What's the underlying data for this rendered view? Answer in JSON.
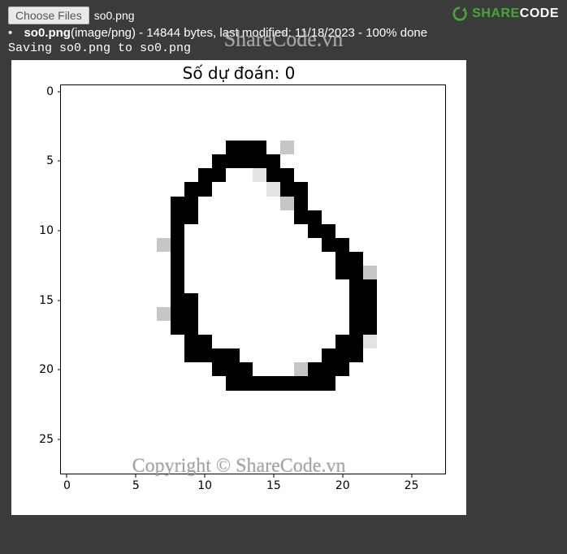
{
  "logo": {
    "share": "SHARE",
    "code": "CODE"
  },
  "watermarks": {
    "center": "ShareCode.vn",
    "bottom": "Copyright © ShareCode.vn"
  },
  "upload": {
    "button_label": "Choose Files",
    "file_label": "so0.png",
    "bullet": "•",
    "fname": "so0.png",
    "info": "(image/png) - 14844 bytes, last modified: 11/18/2023 - 100% done",
    "save_line": "Saving so0.png to so0.png"
  },
  "chart_data": {
    "type": "heatmap",
    "title": "Số dự đoán: 0",
    "xticks": [
      0,
      5,
      10,
      15,
      20,
      25
    ],
    "yticks": [
      0,
      5,
      10,
      15,
      20,
      25
    ],
    "xlim": [
      -0.5,
      27.5
    ],
    "ylim": [
      -0.5,
      27.5
    ],
    "grid_size": [
      28,
      28
    ],
    "cmap": "gray_inverted",
    "pixels": [
      "0000000000000000000000000000",
      "0000000000000000000000000000",
      "0000000000000000000000000000",
      "0000000000000000000000000000",
      "0000000000009990200000000000",
      "0000000000099999000000000000",
      "0000000000990019900000000000",
      "0000000009900001990000000000",
      "0000000099000000290000000000",
      "0000000099000000099000000000",
      "0000000090000000009900000000",
      "0000000290000000000990000000",
      "0000000090000000000099000000",
      "0000000090000000000099200000",
      "0000000090000000000009900000",
      "0000000099000000000009900000",
      "0000000299000000000009900000",
      "0000000099000000000009900000",
      "0000000009900000000099100000",
      "0000000009999000000999000000",
      "0000000000099900029990000000",
      "0000000000009999999900000000",
      "0000000000000000000000000000",
      "0000000000000000000000000000",
      "0000000000000000000000000000",
      "0000000000000000000000000000",
      "0000000000000000000000000000",
      "0000000000000000000000000000"
    ]
  }
}
